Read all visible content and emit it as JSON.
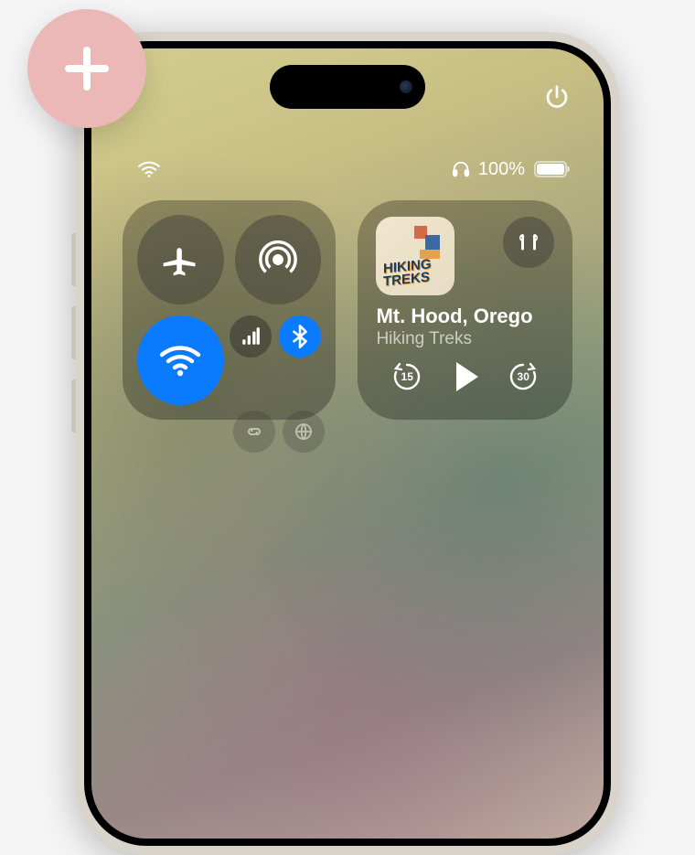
{
  "overlay": {
    "add_button_icon": "plus-icon"
  },
  "status_bar": {
    "battery_text": "100%",
    "headphones_connected": true,
    "wifi_connected": true
  },
  "top_right": {
    "power_icon": "power-icon"
  },
  "connectivity": {
    "airplane": {
      "on": false,
      "icon": "airplane-icon"
    },
    "airdrop": {
      "on": false,
      "icon": "airdrop-icon"
    },
    "wifi": {
      "on": true,
      "icon": "wifi-icon"
    },
    "cellular": {
      "icon": "cellular-bars-icon"
    },
    "bluetooth": {
      "on": true,
      "icon": "bluetooth-icon"
    },
    "extra1": {
      "icon": "link-icon"
    },
    "extra2": {
      "icon": "globe-icon"
    }
  },
  "now_playing": {
    "artwork_text_line1": "HIKING",
    "artwork_text_line2": "TREKS",
    "title": "Mt. Hood, Orego",
    "subtitle": "Hiking Treks",
    "output_icon": "airpods-icon",
    "skip_back_seconds": "15",
    "skip_forward_seconds": "30"
  },
  "colors": {
    "active_blue": "#0a7bff",
    "overlay_pink": "#ecb7b7"
  }
}
